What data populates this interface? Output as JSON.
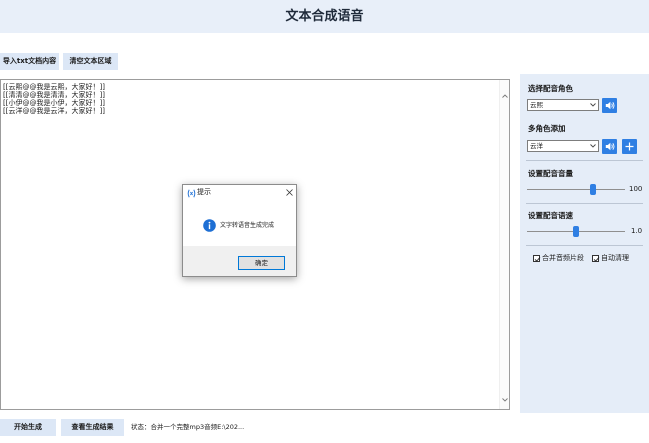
{
  "window": {
    "title": "文本合成语音"
  },
  "toolbar": {
    "import_label": "导入txt文档内容",
    "clear_label": "清空文本区域"
  },
  "editor": {
    "lines": [
      "[[云熙@@我是云熙，大家好！]]",
      "[[清清@@我是清清，大家好！]]",
      "[[小伊@@我是小伊，大家好！]]",
      "[[云洋@@我是云洋，大家好！]]"
    ]
  },
  "settings": {
    "voice_label": "选择配音角色",
    "voice_selected": "云熙",
    "multi_label": "多角色添加",
    "multi_selected": "云洋",
    "volume_label": "设置配音音量",
    "volume_value": "100",
    "volume_level": 0.68,
    "speed_label": "设置配音语速",
    "speed_value": "1.0",
    "speed_level": 0.5,
    "merge_label": "合并音频片段",
    "merge_checked": true,
    "autoclean_label": "自动清理",
    "autoclean_checked": true
  },
  "dialog": {
    "title": "提示",
    "message": "文字转语音生成完成",
    "ok_label": "确定"
  },
  "footer": {
    "start_label": "开始生成",
    "view_label": "查看生成结果",
    "status": "状态：合并一个完整mp3音频E:\\202..."
  },
  "icons": {
    "speaker": "speaker-icon",
    "plus": "plus-icon",
    "info": "info-icon",
    "close": "close-icon",
    "dropdown": "chevron-down-icon",
    "check": "check-icon",
    "dialog_app": "app-icon",
    "scroll_up": "scroll-up-arrow-icon",
    "scroll_down": "scroll-down-arrow-icon"
  },
  "colors": {
    "accent": "#2f7fe3",
    "panel": "#e5edf8",
    "titlebar": "#e8eff9",
    "button": "#dce7f6",
    "info": "#1e6fd4"
  }
}
